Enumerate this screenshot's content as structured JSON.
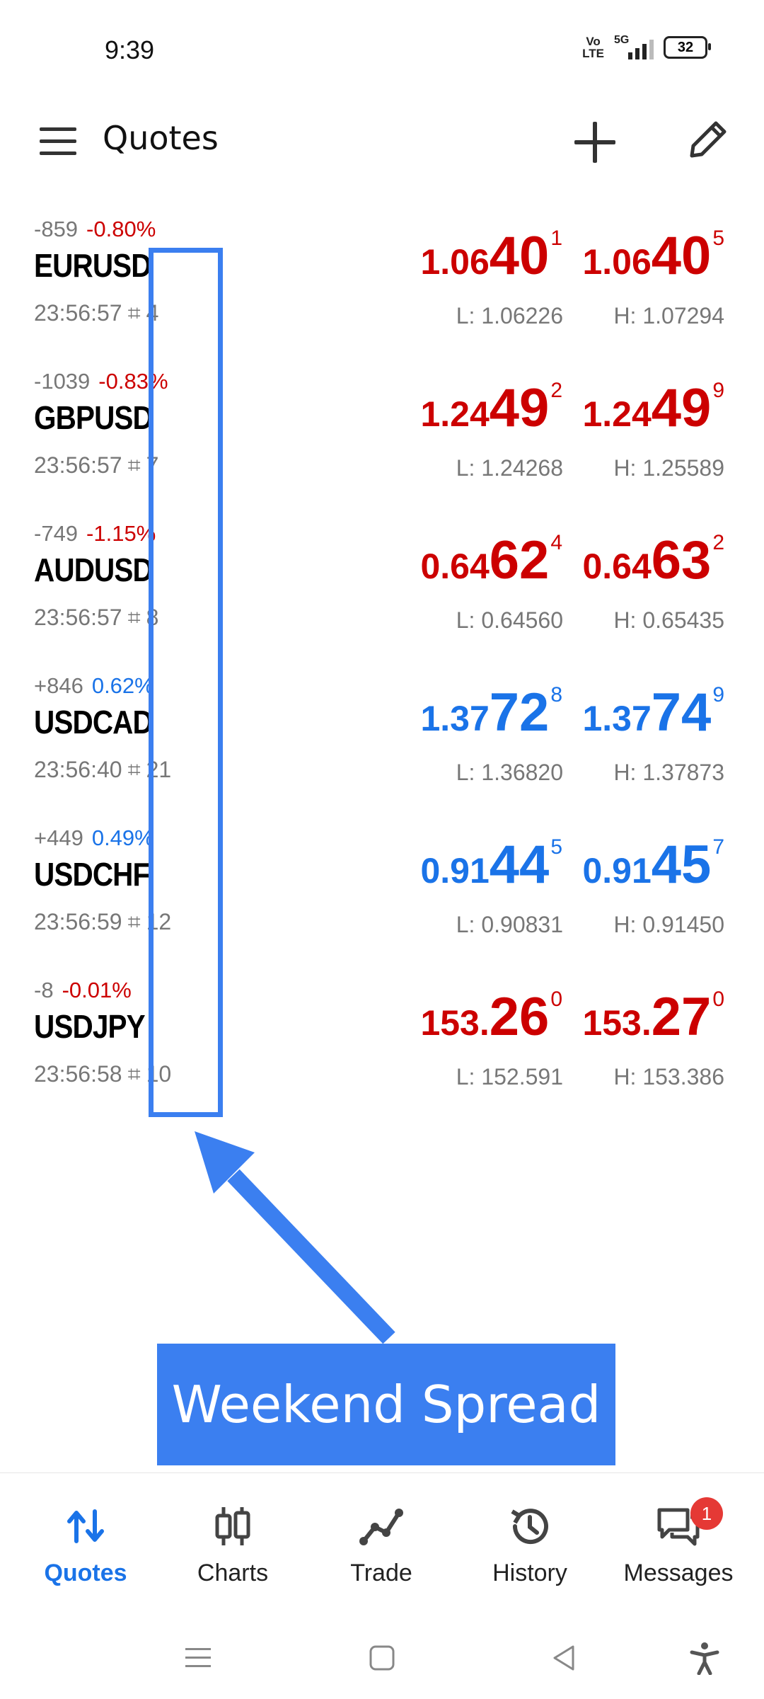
{
  "status_bar": {
    "time": "9:39",
    "volte": "Vo\nLTE",
    "network": "5G",
    "battery": "32"
  },
  "app_bar": {
    "title": "Quotes",
    "menu_icon": "hamburger-menu-icon",
    "add_icon": "plus-icon",
    "edit_icon": "pencil-icon"
  },
  "quotes": [
    {
      "points": "-859",
      "percent": "-0.80%",
      "direction": "down",
      "symbol": "EURUSD",
      "time": "23:56:57",
      "spread": "4",
      "bid": {
        "small": "1.06",
        "big": "40",
        "sup": "1"
      },
      "ask": {
        "small": "1.06",
        "big": "40",
        "sup": "5"
      },
      "low": "L: 1.06226",
      "high": "H: 1.07294"
    },
    {
      "points": "-1039",
      "percent": "-0.83%",
      "direction": "down",
      "symbol": "GBPUSD",
      "time": "23:56:57",
      "spread": "7",
      "bid": {
        "small": "1.24",
        "big": "49",
        "sup": "2"
      },
      "ask": {
        "small": "1.24",
        "big": "49",
        "sup": "9"
      },
      "low": "L: 1.24268",
      "high": "H: 1.25589"
    },
    {
      "points": "-749",
      "percent": "-1.15%",
      "direction": "down",
      "symbol": "AUDUSD",
      "time": "23:56:57",
      "spread": "8",
      "bid": {
        "small": "0.64",
        "big": "62",
        "sup": "4"
      },
      "ask": {
        "small": "0.64",
        "big": "63",
        "sup": "2"
      },
      "low": "L: 0.64560",
      "high": "H: 0.65435"
    },
    {
      "points": "+846",
      "percent": "0.62%",
      "direction": "up",
      "symbol": "USDCAD",
      "time": "23:56:40",
      "spread": "21",
      "bid": {
        "small": "1.37",
        "big": "72",
        "sup": "8"
      },
      "ask": {
        "small": "1.37",
        "big": "74",
        "sup": "9"
      },
      "low": "L: 1.36820",
      "high": "H: 1.37873"
    },
    {
      "points": "+449",
      "percent": "0.49%",
      "direction": "up",
      "symbol": "USDCHF",
      "time": "23:56:59",
      "spread": "12",
      "bid": {
        "small": "0.91",
        "big": "44",
        "sup": "5"
      },
      "ask": {
        "small": "0.91",
        "big": "45",
        "sup": "7"
      },
      "low": "L: 0.90831",
      "high": "H: 0.91450"
    },
    {
      "points": "-8",
      "percent": "-0.01%",
      "direction": "down",
      "symbol": "USDJPY",
      "time": "23:56:58",
      "spread": "10",
      "bid": {
        "small": "153.",
        "big": "26",
        "sup": "0"
      },
      "ask": {
        "small": "153.",
        "big": "27",
        "sup": "0"
      },
      "low": "L: 152.591",
      "high": "H: 153.386"
    }
  ],
  "annotation": {
    "label": "Weekend Spread",
    "color": "#3b7ff0"
  },
  "bottom_nav": [
    {
      "label": "Quotes",
      "icon": "quotes-arrows-icon",
      "active": true
    },
    {
      "label": "Charts",
      "icon": "candlestick-icon",
      "active": false
    },
    {
      "label": "Trade",
      "icon": "trend-line-icon",
      "active": false
    },
    {
      "label": "History",
      "icon": "history-clock-icon",
      "active": false
    },
    {
      "label": "Messages",
      "icon": "chat-bubbles-icon",
      "active": false,
      "badge": "1"
    }
  ],
  "colors": {
    "down": "#cc0000",
    "up": "#1a73e8",
    "accent": "#1a73e8"
  }
}
